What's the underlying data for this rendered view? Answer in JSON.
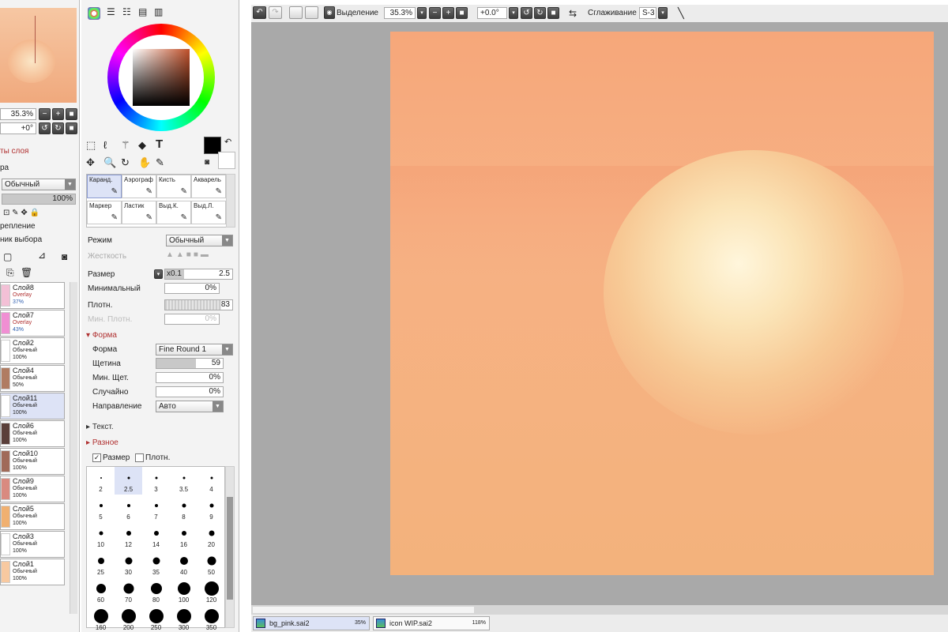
{
  "left_panel": {
    "zoom": "35.3%",
    "angle": "+0°",
    "section_label": "ты слоя",
    "section_label2": "ра",
    "blend_mode": "Обычный",
    "opacity": "100%",
    "check1": "реплениe",
    "check2": "ник выбора",
    "layers": [
      {
        "name": "Слой8",
        "mode": "Overlay",
        "opacity": "37%",
        "thumb": "#f3c0d6",
        "selected": false
      },
      {
        "name": "Слой7",
        "mode": "Overlay",
        "opacity": "43%",
        "thumb": "#f08fd3",
        "selected": false
      },
      {
        "name": "Слой2",
        "mode": "Обычный",
        "opacity": "100%",
        "thumb": "#ffffff",
        "selected": false
      },
      {
        "name": "Слой4",
        "mode": "Обычный",
        "opacity": "50%",
        "thumb": "#b07c62",
        "selected": false
      },
      {
        "name": "Слой11",
        "mode": "Обычный",
        "opacity": "100%",
        "thumb": "#ffffff",
        "selected": true
      },
      {
        "name": "Слой6",
        "mode": "Обычный",
        "opacity": "100%",
        "thumb": "#5a3f3a",
        "selected": false
      },
      {
        "name": "Слой10",
        "mode": "Обычный",
        "opacity": "100%",
        "thumb": "#a06a58",
        "selected": false
      },
      {
        "name": "Слой9",
        "mode": "Обычный",
        "opacity": "100%",
        "thumb": "#d98a80",
        "selected": false
      },
      {
        "name": "Слой5",
        "mode": "Обычный",
        "opacity": "100%",
        "thumb": "#f0b070",
        "selected": false
      },
      {
        "name": "Слой3",
        "mode": "Обычный",
        "opacity": "100%",
        "thumb": "#ffffff",
        "selected": false
      },
      {
        "name": "Слой1",
        "mode": "Обычный",
        "opacity": "100%",
        "thumb": "#f8c9a0",
        "selected": false
      }
    ]
  },
  "tools": {
    "brushes": [
      {
        "label": "Каранд.",
        "selected": true
      },
      {
        "label": "Аэрограф",
        "selected": false
      },
      {
        "label": "Кисть",
        "selected": false
      },
      {
        "label": "Акварель",
        "selected": false
      },
      {
        "label": "Маркер",
        "selected": false
      },
      {
        "label": "Ластик",
        "selected": false
      },
      {
        "label": "Выд.К.",
        "selected": false
      },
      {
        "label": "Выд.Л.",
        "selected": false
      }
    ],
    "mode_label": "Режим",
    "mode_value": "Обычный",
    "hardness_label": "Жесткость",
    "size_label": "Размер",
    "size_mult": "x0.1",
    "size_value": "2.5",
    "min_size_label": "Минимальный",
    "min_size_value": "0%",
    "density_label": "Плотн.",
    "density_value": "83",
    "min_density_label": "Мин. Плотн.",
    "min_density_value": "0%",
    "form_section": "Форма",
    "form_label": "Форма",
    "form_value": "Fine Round 1",
    "bristle_label": "Щетина",
    "bristle_value": "59",
    "min_bristle_label": "Мин. Щет.",
    "min_bristle_value": "0%",
    "random_label": "Случайно",
    "random_value": "0%",
    "direction_label": "Направление",
    "direction_value": "Авто",
    "texture_section": "Текст.",
    "misc_section": "Разное",
    "check_size": "Размер",
    "check_density": "Плотн.",
    "brush_sizes": [
      "2",
      "2.5",
      "3",
      "3.5",
      "4",
      "5",
      "6",
      "7",
      "8",
      "9",
      "10",
      "12",
      "14",
      "16",
      "20",
      "25",
      "30",
      "35",
      "40",
      "50",
      "60",
      "70",
      "80",
      "100",
      "120",
      "160",
      "200",
      "250",
      "300",
      "350"
    ],
    "selected_size": "2.5"
  },
  "topbar": {
    "selection_label": "Выделение",
    "zoom": "35.3%",
    "angle": "+0.0°",
    "smoothing_label": "Сглаживание",
    "smoothing_value": "S-3"
  },
  "tabs": [
    {
      "name": "bg_pink.sai2",
      "zoom": "35%",
      "active": true
    },
    {
      "name": "icon WIP.sai2",
      "zoom": "118%",
      "active": false
    }
  ],
  "colors": {
    "primary": "#000000",
    "secondary": "#ffffff",
    "canvas_bg": "#a9a9a9",
    "accent_section": "#b03030"
  }
}
